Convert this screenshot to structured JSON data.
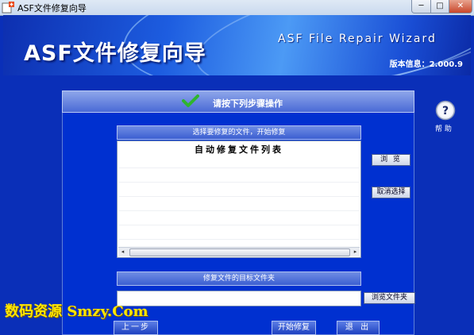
{
  "window": {
    "title": "ASF文件修复向导",
    "minimize_glyph": "─",
    "maximize_glyph": "□",
    "close_glyph": "✕"
  },
  "header": {
    "title": "ASF文件修复向导",
    "subtitle": "ASF File Repair Wizard",
    "version": "版本信息：2.000.9"
  },
  "help": {
    "label": "帮 助",
    "icon": "help-icon"
  },
  "panel": {
    "title": "请按下列步骤操作",
    "icon": "check-icon"
  },
  "file_list": {
    "section_title": "选择要修复的文件，开始修复",
    "column_title": "自动修复文件列表",
    "items": [],
    "scroll_left": "◂",
    "scroll_right": "▸"
  },
  "side_buttons": {
    "browse": "浏 览",
    "deselect": "取消选择"
  },
  "target": {
    "section_title": "修复文件的目标文件夹",
    "value": "",
    "browse_folder": "浏览文件夹"
  },
  "footer": {
    "prev": "上一步",
    "start": "开始修复",
    "exit": "退 出"
  },
  "watermark": "数码资源 Smzy.Com",
  "colors": {
    "background": "#0a2fb8",
    "accent": "#1d5de0",
    "watermark": "#ffe600"
  }
}
